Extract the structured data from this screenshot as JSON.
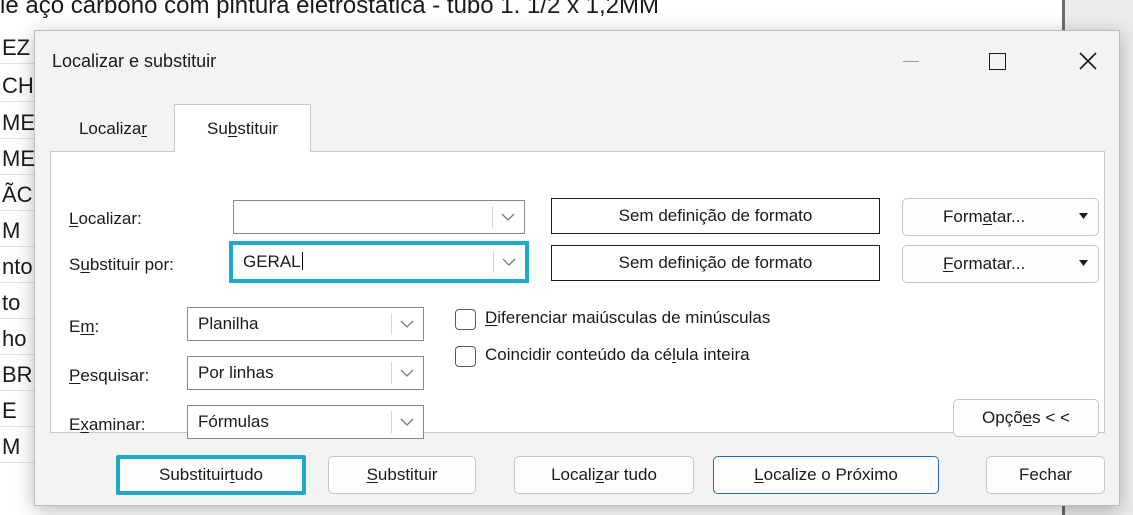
{
  "sheet": {
    "top_text": "le aço carbono com pintura eletrostática - tubo 1. 1/2 x 1,2MM",
    "cells": [
      "EZ",
      "CH",
      "ME",
      "ME",
      "ÃC",
      "M",
      "nto",
      "to",
      "ho",
      "BR",
      "E",
      "M"
    ]
  },
  "dialog": {
    "title": "Localizar e substituir",
    "tabs": {
      "find": {
        "pre": "Localiza",
        "key": "r",
        "post": ""
      },
      "replace": {
        "pre": "Su",
        "key": "b",
        "post": "stituir"
      }
    },
    "find_label": {
      "pre": "",
      "key": "L",
      "post": "ocalizar:"
    },
    "find_value": "",
    "replace_label": {
      "pre": "S",
      "key": "u",
      "post": "bstituir por:"
    },
    "replace_value": "GERAL",
    "no_format_1": "Sem definição de formato",
    "no_format_2": "Sem definição de formato",
    "format_btn_1": {
      "pre": "Form",
      "key": "a",
      "post": "tar..."
    },
    "format_btn_2": {
      "pre": "",
      "key": "F",
      "post": "ormatar..."
    },
    "within_label": {
      "pre": "E",
      "key": "m",
      "post": ":"
    },
    "within_value": "Planilha",
    "search_label": {
      "pre": "",
      "key": "P",
      "post": "esquisar:"
    },
    "search_value": "Por linhas",
    "lookin_label": {
      "pre": "E",
      "key": "x",
      "post": "aminar:"
    },
    "lookin_value": "Fórmulas",
    "match_case": {
      "pre": "",
      "key": "D",
      "post": "iferenciar maiúsculas de minúsculas",
      "checked": false
    },
    "match_entire": {
      "pre": "Coincidir conteúdo da cé",
      "key": "l",
      "post": "ula inteira",
      "checked": false
    },
    "options_btn": {
      "pre": "Opçõ",
      "key": "e",
      "post": "s < <"
    },
    "buttons": {
      "replace_all": {
        "pre": "Substituir ",
        "key": "t",
        "post": "udo"
      },
      "replace": {
        "pre": "",
        "key": "S",
        "post": "ubstituir"
      },
      "find_all": {
        "pre": "Locali",
        "key": "z",
        "post": "ar tudo"
      },
      "find_next": {
        "pre": "",
        "key": "L",
        "post": "ocalize o Próximo"
      },
      "close": {
        "pre": "",
        "key": "",
        "post": "Fechar"
      }
    }
  },
  "colors": {
    "highlight": "#1ea9c7",
    "primary_border": "#1f6fb5"
  }
}
